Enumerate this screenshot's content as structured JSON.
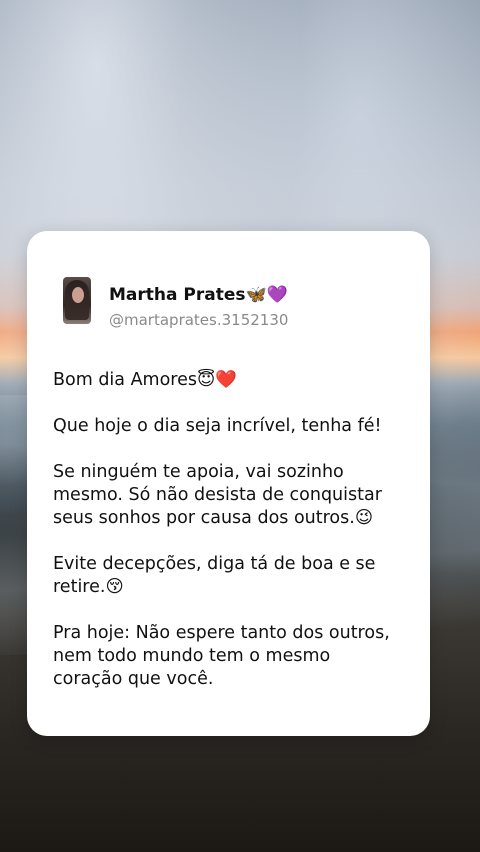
{
  "post": {
    "author_name": "Martha Prates🦋💜",
    "author_handle": "@martaprates.3152130",
    "paragraphs": [
      "Bom dia Amores😇❤️",
      "Que hoje o dia seja incrível, tenha fé!",
      "Se ninguém te apoia, vai sozinho\nmesmo. Só não desista de conquistar\nseus sonhos por causa dos outros.😉",
      "Evite decepções, diga tá de boa e se\nretire.😚",
      "Pra hoje: Não espere tanto dos outros,\nnem todo mundo tem o mesmo\ncoração que você."
    ]
  },
  "icons": {
    "avatar": "profile-photo"
  },
  "colors": {
    "card_background": "#ffffff",
    "text_primary": "#111111",
    "text_secondary": "#8a8a8a"
  }
}
